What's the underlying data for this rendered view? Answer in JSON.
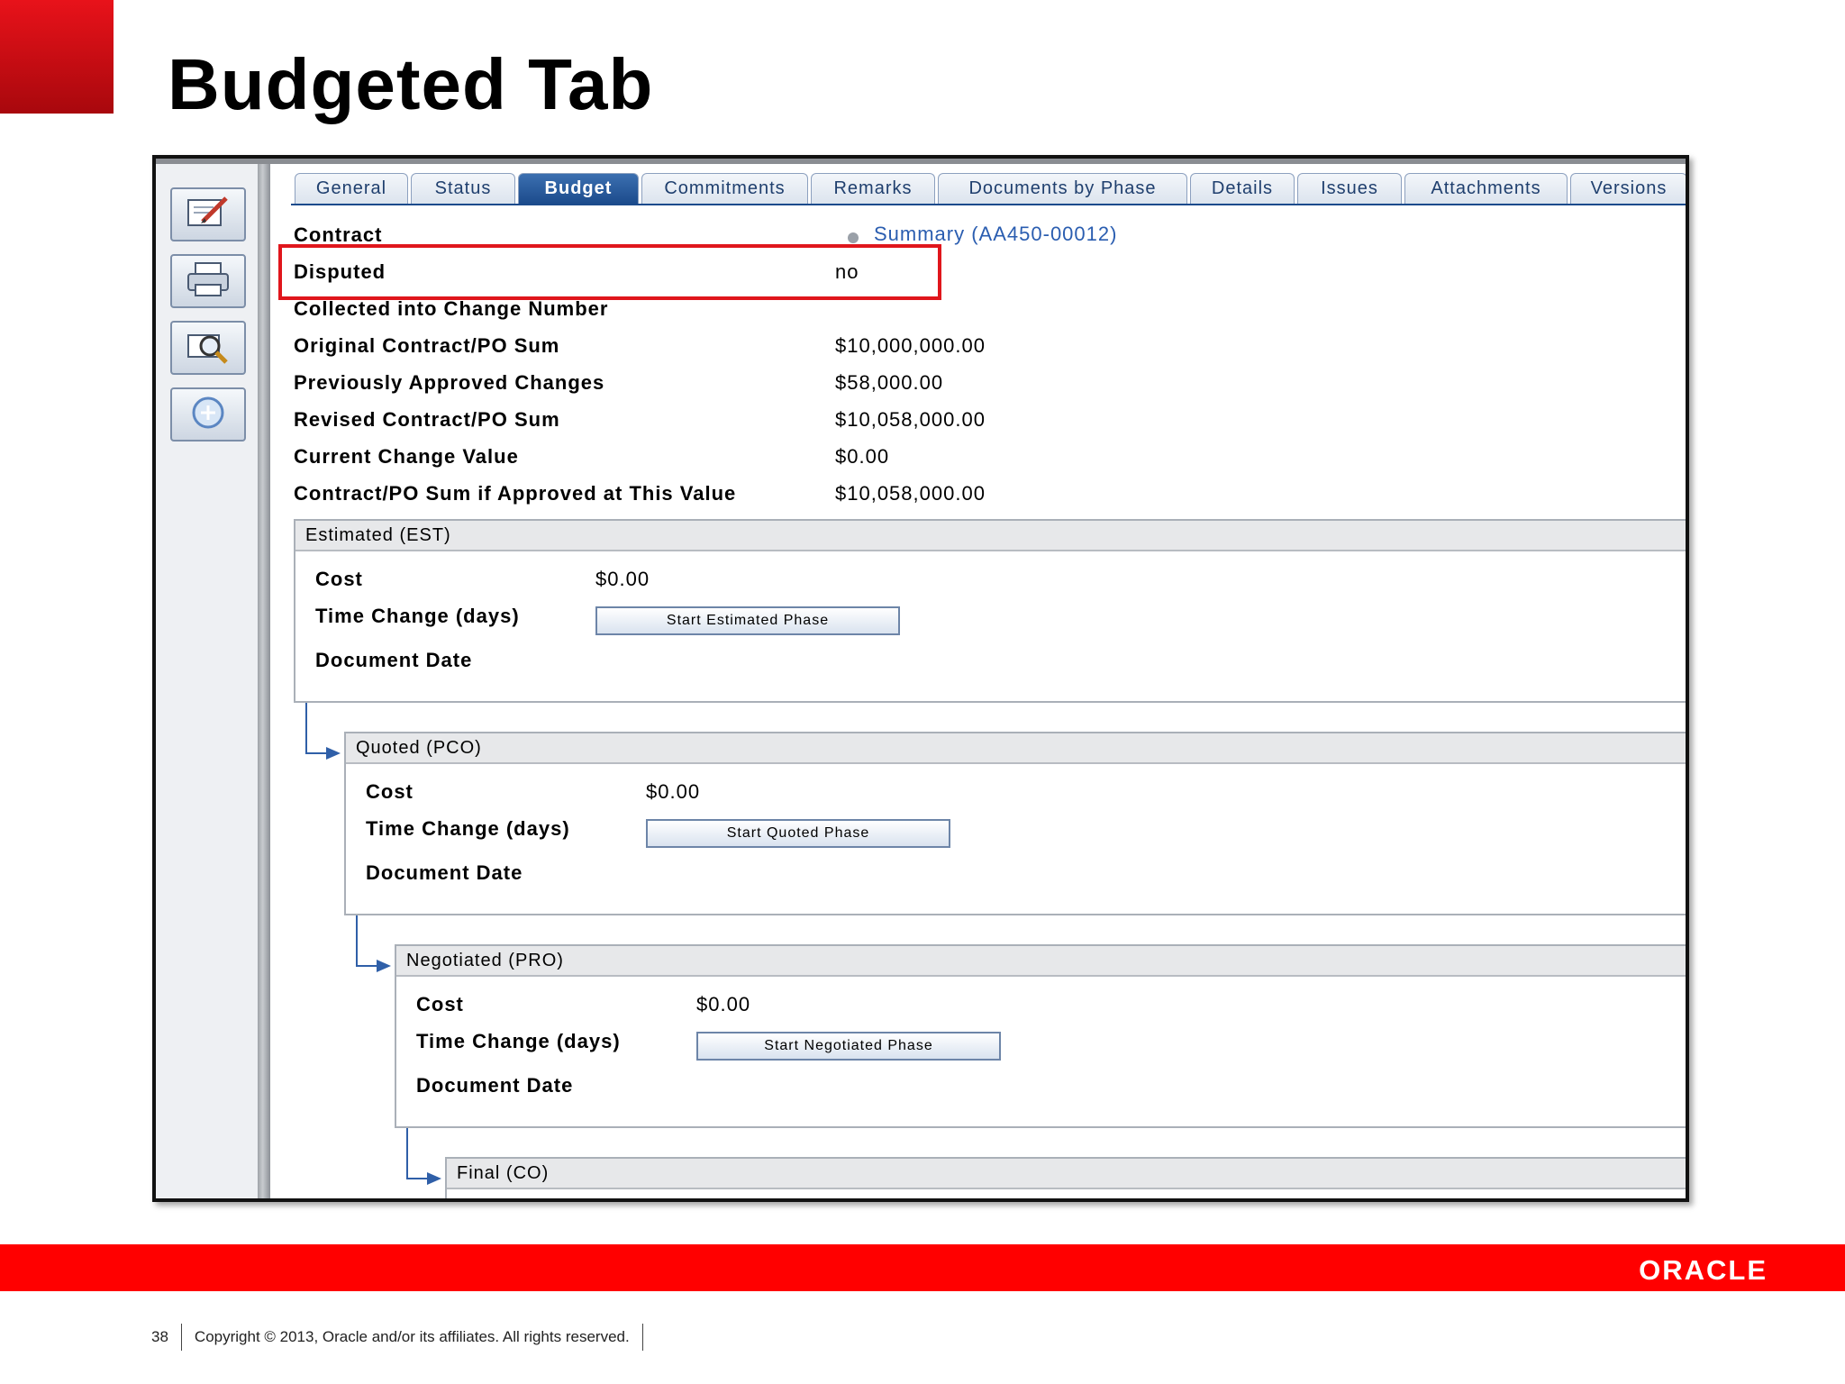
{
  "slide": {
    "title": "Budgeted Tab",
    "page_number": "38",
    "copyright": "Copyright © 2013, Oracle and/or its affiliates. All rights reserved.",
    "logo_text": "ORACLE"
  },
  "toolbar": {
    "tools": [
      "edit-icon",
      "print-icon",
      "find-icon",
      "add-icon"
    ]
  },
  "tabs": [
    {
      "label": "General"
    },
    {
      "label": "Status"
    },
    {
      "label": "Budget",
      "active": true
    },
    {
      "label": "Commitments"
    },
    {
      "label": "Remarks"
    },
    {
      "label": "Documents by Phase"
    },
    {
      "label": "Details"
    },
    {
      "label": "Issues"
    },
    {
      "label": "Attachments"
    },
    {
      "label": "Versions"
    }
  ],
  "fields": {
    "contract_label": "Contract",
    "contract_link": "Summary (AA450-00012)",
    "disputed_label": "Disputed",
    "disputed_value": "no",
    "collected_label": "Collected into Change Number",
    "original_label": "Original Contract/PO Sum",
    "original_value": "$10,000,000.00",
    "prev_label": "Previously Approved Changes",
    "prev_value": "$58,000.00",
    "revised_label": "Revised Contract/PO Sum",
    "revised_value": "$10,058,000.00",
    "current_label": "Current Change Value",
    "current_value": "$0.00",
    "ifapproved_label": "Contract/PO Sum if Approved at This Value",
    "ifapproved_value": "$10,058,000.00"
  },
  "phases": [
    {
      "title": "Estimated (EST)",
      "cost_label": "Cost",
      "cost_value": "$0.00",
      "time_label": "Time Change (days)",
      "date_label": "Document Date",
      "button": "Start Estimated Phase"
    },
    {
      "title": "Quoted (PCO)",
      "cost_label": "Cost",
      "cost_value": "$0.00",
      "time_label": "Time Change (days)",
      "date_label": "Document Date",
      "button": "Start Quoted Phase"
    },
    {
      "title": "Negotiated (PRO)",
      "cost_label": "Cost",
      "cost_value": "$0.00",
      "time_label": "Time Change (days)",
      "date_label": "Document Date",
      "button": "Start Negotiated Phase"
    },
    {
      "title": "Final (CO)"
    }
  ],
  "colors": {
    "accent_red": "#ff0000",
    "tab_active": "#1c4b8c",
    "link": "#2a5db0",
    "highlight_box": "#e0161c"
  }
}
